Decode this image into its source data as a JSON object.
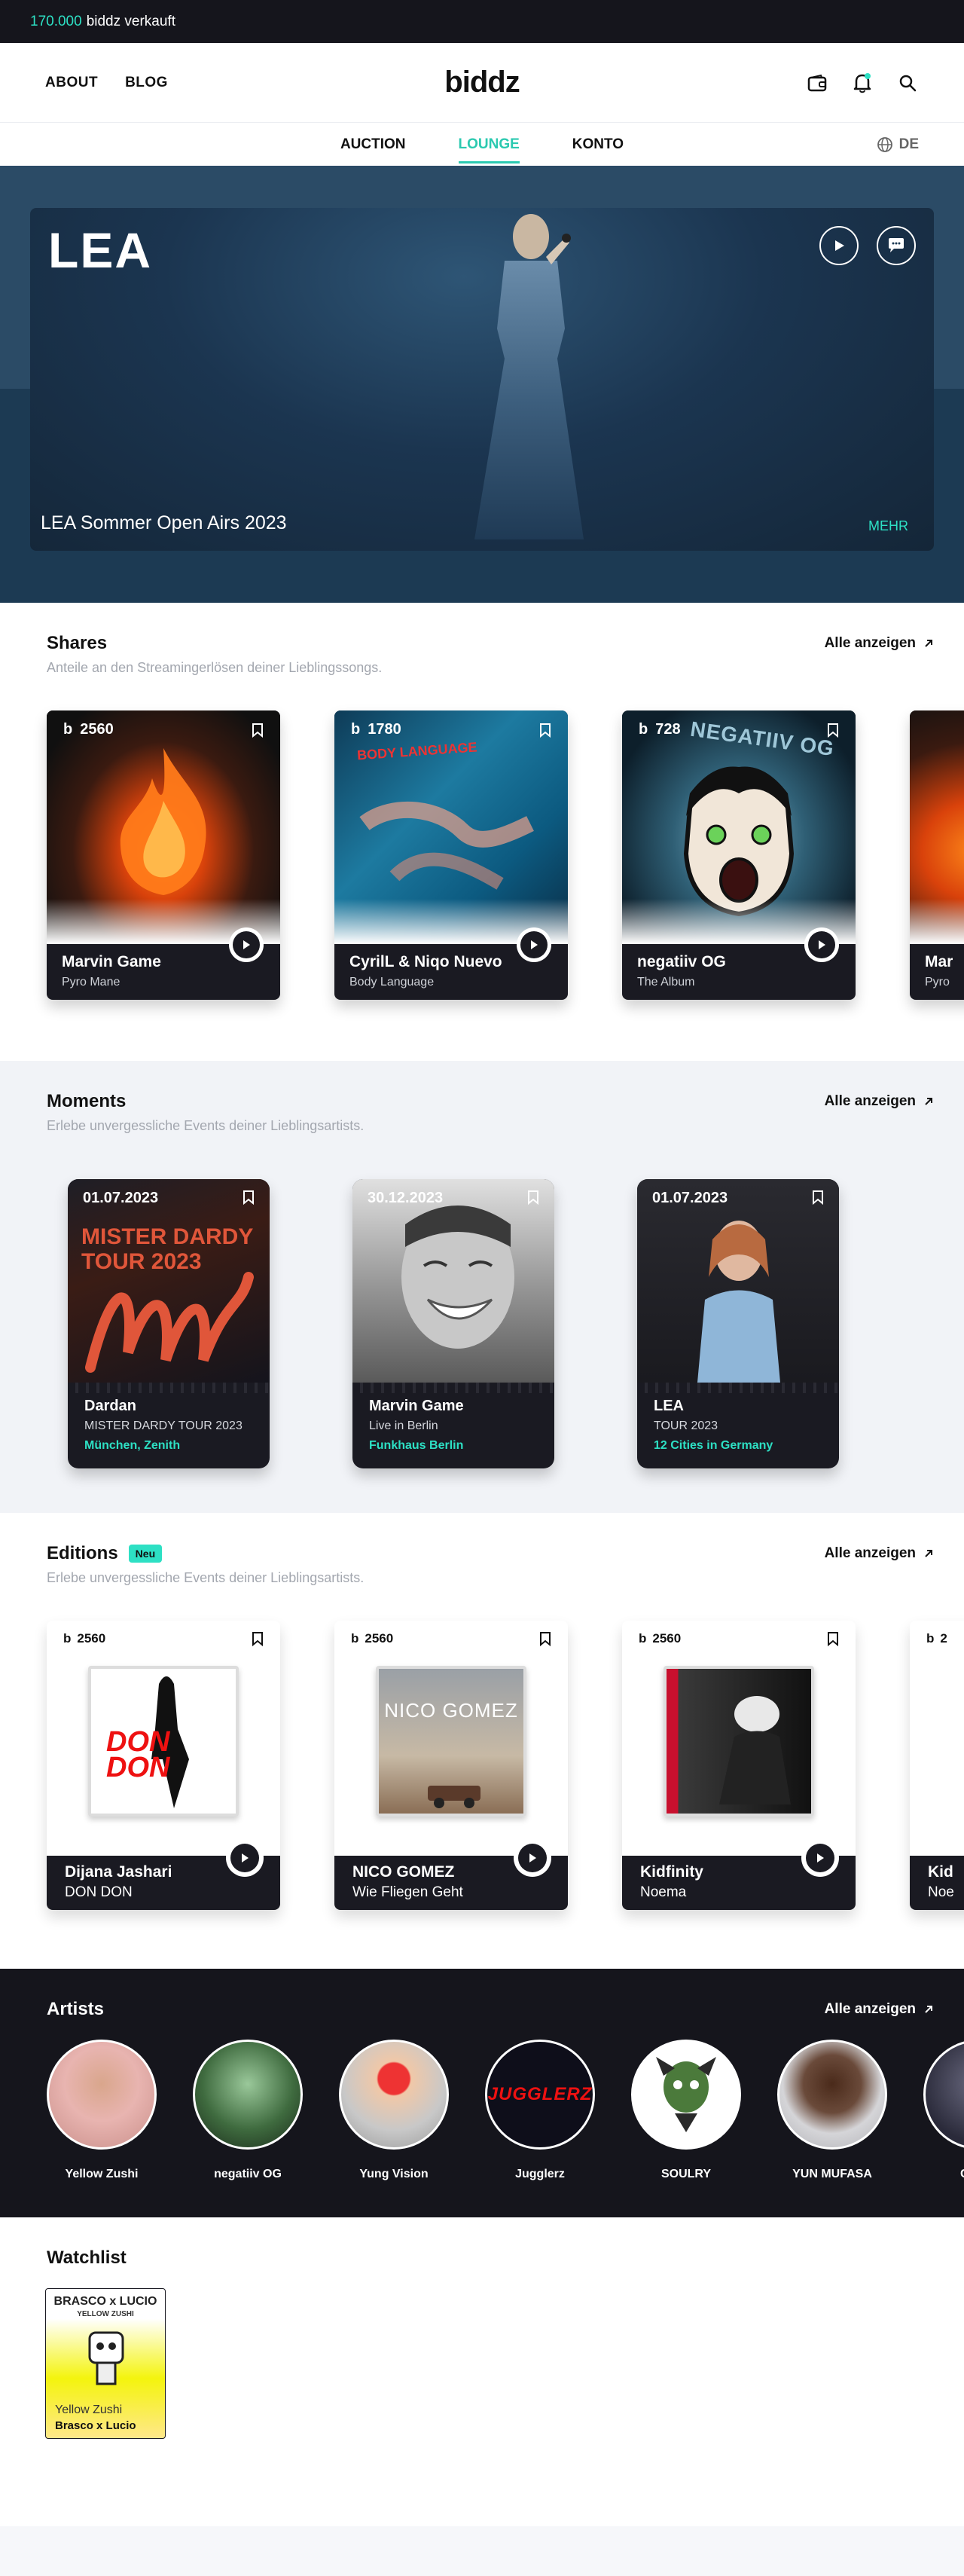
{
  "topbar": {
    "count": "170.000",
    "text": "biddz verkauft"
  },
  "header": {
    "nav": {
      "about": "ABOUT",
      "blog": "BLOG"
    },
    "logo": "biddz",
    "icons": [
      "wallet-icon",
      "bell-icon",
      "search-icon"
    ]
  },
  "subnav": {
    "tabs": [
      {
        "label": "AUCTION",
        "active": false
      },
      {
        "label": "LOUNGE",
        "active": true
      },
      {
        "label": "KONTO",
        "active": false
      }
    ],
    "language": "DE"
  },
  "hero": {
    "title": "LEA",
    "subtitle": "LEA Sommer Open Airs 2023",
    "more": "MEHR"
  },
  "shares": {
    "title": "Shares",
    "description": "Anteile an den Streamingerlösen deiner Lieblingssongs.",
    "see_all": "Alle anzeigen",
    "items": [
      {
        "count": "2560",
        "title": "Marvin Game",
        "subtitle": "Pyro Mane"
      },
      {
        "count": "1780",
        "title": "CyrilL & Niqo Nuevo",
        "subtitle": "Body Language",
        "art_text": "BODY LANGUAGE"
      },
      {
        "count": "728",
        "title": "negatiiv OG",
        "subtitle": "The Album",
        "art_text": "NEGATIIV OG"
      },
      {
        "title": "Mar",
        "subtitle": "Pyro"
      }
    ]
  },
  "moments": {
    "title": "Moments",
    "description": "Erlebe unvergessliche Events deiner Lieblingsartists.",
    "see_all": "Alle anzeigen",
    "items": [
      {
        "date": "01.07.2023",
        "title": "Dardan",
        "subtitle": "MISTER DARDY TOUR 2023",
        "location": "München, Zenith",
        "art_text": "MISTER DARDY TOUR 2023"
      },
      {
        "date": "30.12.2023",
        "title": "Marvin Game",
        "subtitle": "Live in Berlin",
        "location": "Funkhaus Berlin"
      },
      {
        "date": "01.07.2023",
        "title": "LEA",
        "subtitle": "TOUR 2023",
        "location": "12 Cities in Germany"
      }
    ]
  },
  "editions": {
    "title": "Editions",
    "badge": "Neu",
    "description": "Erlebe unvergessliche Events deiner Lieblingsartists.",
    "see_all": "Alle anzeigen",
    "items": [
      {
        "count": "2560",
        "title": "Dijana Jashari",
        "subtitle": "DON DON",
        "art_text": "DON DON"
      },
      {
        "count": "2560",
        "title": "NICO GOMEZ",
        "subtitle": "Wie Fliegen Geht",
        "art_text": "NICO GOMEZ"
      },
      {
        "count": "2560",
        "title": "Kidfinity",
        "subtitle": "Noema"
      },
      {
        "count": "2",
        "title": "Kid",
        "subtitle": "Noe"
      }
    ]
  },
  "artists": {
    "title": "Artists",
    "see_all": "Alle anzeigen",
    "items": [
      {
        "name": "Yellow Zushi",
        "color": "#e8b4b0"
      },
      {
        "name": "negatiiv OG",
        "color": "#3f6b3f"
      },
      {
        "name": "Yung Vision",
        "color": "#c8c8c8"
      },
      {
        "name": "Jugglerz",
        "color": "#0e0e1a",
        "art_text": "JUGGLERZ"
      },
      {
        "name": "SOULRY",
        "color": "#ffffff"
      },
      {
        "name": "YUN MUFASA",
        "color": "#d5d5d8"
      },
      {
        "name": "CYMO",
        "color": "#2a2a3a"
      }
    ]
  },
  "watchlist": {
    "title": "Watchlist",
    "items": [
      {
        "cover_title": "BRASCO x LUCIO",
        "cover_subtitle": "YELLOW ZUSHI",
        "artist": "Yellow Zushi",
        "title": "Brasco x Lucio"
      }
    ]
  },
  "colors": {
    "accent": "#2de0c4",
    "dark": "#15151c",
    "hero": "#1c3a53"
  }
}
